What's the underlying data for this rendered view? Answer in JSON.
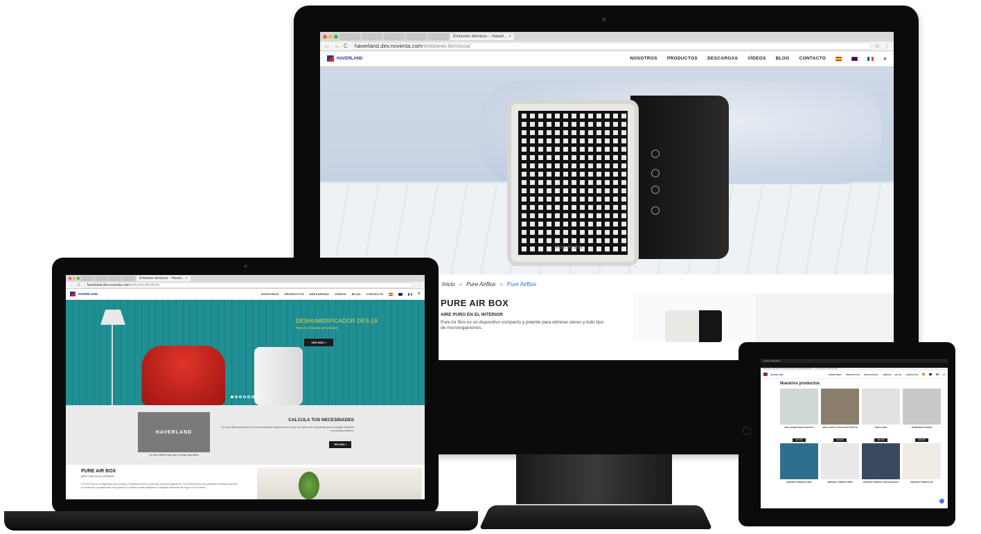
{
  "imac": {
    "tabs": [
      "Emisores térmicos – Haverl... ×"
    ],
    "url_host": "haverland.dev.noventa.com",
    "url_path": "/emisores-termicos/",
    "logo_text": "HAVERLAND",
    "nav": [
      "NOSOTROS",
      "PRODUCTOS",
      "DESCARGAS",
      "VÍDEOS",
      "BLOG",
      "CONTACTO"
    ],
    "device_label": "Pure Air Box",
    "breadcrumb": {
      "home": "Inicio",
      "sep": "»",
      "mid": "Pure AirBox",
      "current": "Pure AirBox"
    },
    "product": {
      "title": "PURE AIR BOX",
      "subtitle": "AIRE PURO EN EL INTERIOR",
      "description": "Pure Air Box es un dispositivo compacto y potente para eliminar olores y todo tipo de microorganismos."
    }
  },
  "laptop": {
    "tabs": [
      "Emisores térmicos – Haverl... ×"
    ],
    "url_host": "haverland.dev.noventa.com",
    "url_path": "/emisores-termicos/",
    "logo_text": "HAVERLAND",
    "nav": [
      "NOSOTROS",
      "PRODUCTOS",
      "DESCARGAS",
      "VÍDEOS",
      "BLOG",
      "CONTACTO"
    ],
    "hero": {
      "title": "DESHUMIDIFICADOR DES-19",
      "subtitle": "Para el control de la humedad",
      "button": "VER MÁS »"
    },
    "calc": {
      "image_text": "HAVERLAND",
      "caption": "Un buen diseño hace que un hogar sea cálido",
      "title": "CALCULA TUS NECESIDADES",
      "description": "Un buen dimensionamiento de tus necesidades específicas en una de las claves más importantes para conseguir eficiencia en la factura eléctrica.",
      "button": "VER MÁS »"
    },
    "product": {
      "title": "PURE AIR BOX",
      "subtitle": "AIRE PURO EN EL INTERIOR",
      "description": "Pure Air Box es un dispositivo que purifica y desinfecta olores y todo tipo de microorganismos. Sus dimensiones son pequeñas mientras potencia en funciones y prestaciones. Ha gracias a su diseño puede adaptarse a cualquier ambiente del hogar o de la oficina."
    }
  },
  "tablet": {
    "status": "12:28 •  Haverland",
    "strip": "Oferta de temporada en emisores térmicos y deshumidificadores — envío gratuito a partir de 99€",
    "logo_text": "HAVERLAND",
    "nav": [
      "NOSOTROS",
      "PRODUCTOS",
      "DESCARGAS",
      "VÍDEOS",
      "BLOG",
      "CONTACTO"
    ],
    "heading": "Nuestros productos",
    "products": [
      {
        "name": "AIRE ACONDICIONADO PORTÁTIL",
        "button": "VER MÁS",
        "color": "#cfd7d4"
      },
      {
        "name": "VENTILACIÓN Y EXTRACCIÓN PORTÁTIL",
        "button": "VER MÁS",
        "color": "#8b7f6b"
      },
      {
        "name": "VENTILACIÓN",
        "button": "VER MÁS",
        "color": "#e2e2e0"
      },
      {
        "name": "TERMOVENTILADORES",
        "button": "VER MÁS",
        "color": "#c9c9c9"
      },
      {
        "name": "EMISORES TÉRMICOS SERIE",
        "button": "",
        "color": "#2e6f8e"
      },
      {
        "name": "EMISORES TÉRMICOS SERIE",
        "button": "",
        "color": "#e9e9e9"
      },
      {
        "name": "EMISORES TÉRMICOS PROGRAMABLES",
        "button": "",
        "color": "#3a4a5e"
      },
      {
        "name": "EMISORES TÉRMICOS RD",
        "button": "",
        "color": "#efece6"
      }
    ]
  },
  "colors": {
    "brand_blue": "#1d3a8a",
    "brand_red": "#d62828",
    "link_blue": "#2a6fdb",
    "hero_teal": "#1f8f93",
    "hero_yellow": "#ffd23f"
  }
}
